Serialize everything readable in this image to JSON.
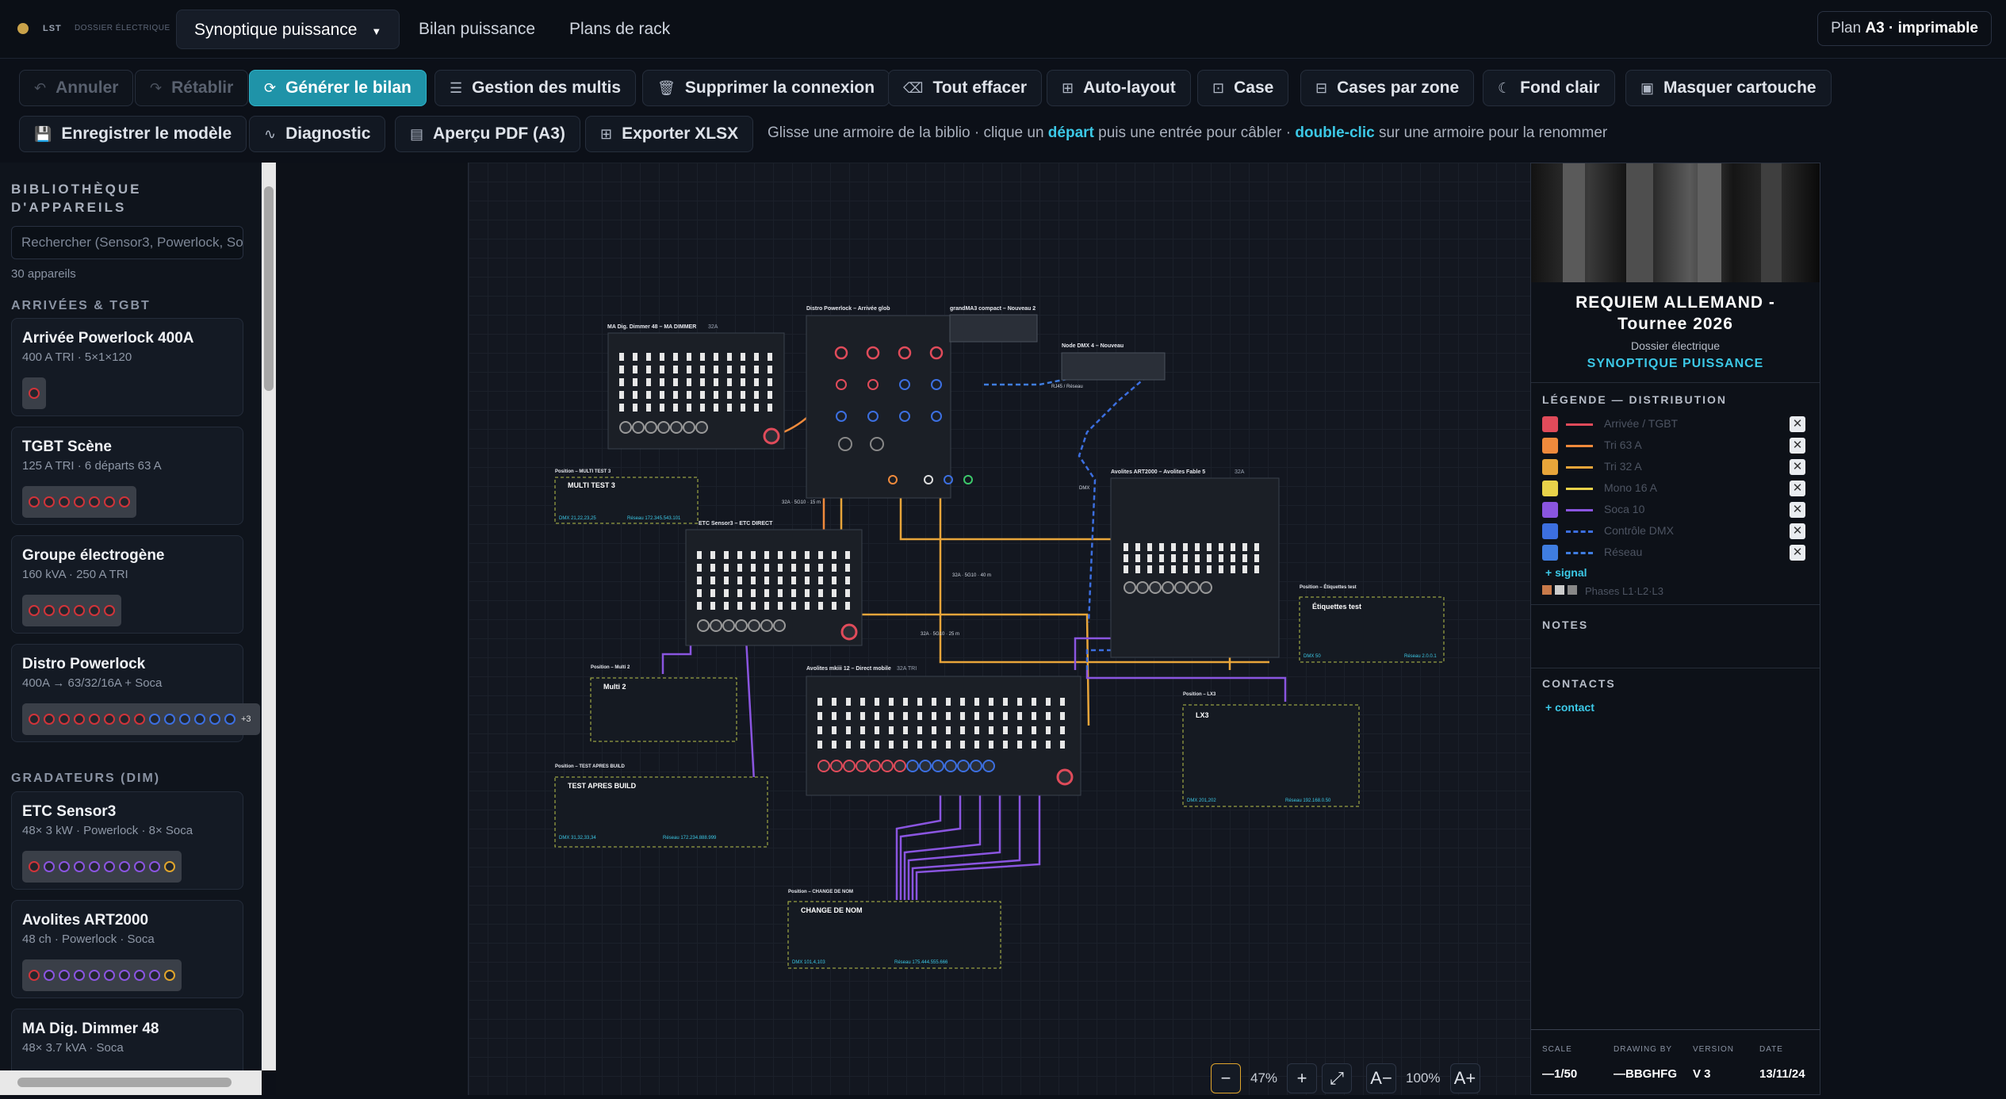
{
  "app": {
    "brand": "LST",
    "brand_sub": "DOSSIER ÉLECTRIQUE"
  },
  "tabs": [
    {
      "label": "Synoptique puissance",
      "active": true
    },
    {
      "label": "Bilan puissance"
    },
    {
      "label": "Plans de rack"
    }
  ],
  "plan": {
    "prefix": "Plan",
    "format": "A3 · imprimable"
  },
  "toolbar": {
    "undo": "Annuler",
    "redo": "Rétablir",
    "generate": "Générer le bilan",
    "multis": "Gestion des multis",
    "delete_conn": "Supprimer la connexion",
    "clear_all": "Tout effacer",
    "auto_layout": "Auto-layout",
    "box": "Case",
    "boxes_by_zone": "Cases par zone",
    "light_bg": "Fond clair",
    "hide_cartouche": "Masquer cartouche",
    "save_model": "Enregistrer le modèle",
    "diagnostic": "Diagnostic",
    "pdf_preview": "Aperçu PDF (A3)",
    "export_xlsx": "Exporter XLSX"
  },
  "hint": {
    "a": "Glisse une armoire de la biblio · clique un ",
    "b": "départ",
    "c": " puis une entrée pour câbler · ",
    "d": "double-clic",
    "e": " sur une armoire pour la renommer"
  },
  "sidebar": {
    "title": "BIBLIOTHÈQUE D'APPAREILS",
    "search_placeholder": "Rechercher (Sensor3, Powerlock, Soca...)",
    "count": "30 appareils",
    "section_arrivals": "ARRIVÉES & TGBT",
    "section_dimmers": "GRADATEURS (DIM)",
    "devices": [
      {
        "name": "Arrivée Powerlock 400A",
        "spec": "400 A TRI · 5×1×120"
      },
      {
        "name": "TGBT Scène",
        "spec": "125 A TRI · 6 départs 63 A"
      },
      {
        "name": "Groupe électrogène",
        "spec": "160 kVA · 250 A TRI"
      },
      {
        "name": "Distro Powerlock",
        "spec": "400A → 63/32/16A + Soca",
        "more": "+3"
      },
      {
        "name": "ETC Sensor3",
        "spec": "48× 3 kW · Powerlock · 8× Soca"
      },
      {
        "name": "Avolites ART2000",
        "spec": "48 ch · Powerlock · Soca"
      },
      {
        "name": "MA Dig. Dimmer 48",
        "spec": "48× 3.7 kVA · Soca"
      }
    ]
  },
  "canvas": {
    "blocks": {
      "ma": {
        "title": "MA Dig. Dimmer 48 – MA DIMMER",
        "rating": "32A"
      },
      "distro": {
        "title": "Distro Powerlock – Arrivée glob"
      },
      "grandma": {
        "title": "grandMA3 compact – Nouveau 2"
      },
      "node": {
        "title": "Node DMX 4 – Nouveau"
      },
      "avo": {
        "title": "Avolites ART2000 – Avolites Fable 5",
        "rating": "32A"
      },
      "etc": {
        "title": "ETC Sensor3 – ETC DIRECT"
      },
      "avo2": {
        "title": "Avolites mkiii 12 – Direct mobile",
        "rating": "32A TRI"
      },
      "multi3": {
        "pos": "Position – MULTI TEST 3",
        "name": "MULTI TEST 3",
        "dmx": "DMX 21,22,23,25",
        "net": "Réseau 172.345.543.101"
      },
      "multi2": {
        "pos": "Position – Multi 2",
        "name": "Multi 2"
      },
      "testapres": {
        "pos": "Position – TEST APRES BUILD",
        "name": "TEST APRES BUILD",
        "dmx": "DMX 31,32,33,34",
        "net": "Réseau 172.234.888.999"
      },
      "etiq": {
        "pos": "Position – Étiquettes test",
        "name": "Étiquettes test",
        "dmx": "DMX 50",
        "net": "Réseau 2.0.0.1"
      },
      "lx3": {
        "pos": "Position – LX3",
        "name": "LX3",
        "dmx": "DMX 201,202",
        "net": "Réseau 192.168.0.50"
      },
      "change": {
        "pos": "Position – CHANGE DE NOM",
        "name": "CHANGE DE NOM",
        "dmx": "DMX 101,4,103",
        "net": "Réseau 175.444.555.666"
      }
    },
    "cable_labels": [
      "32A · 5G10 · 15 m",
      "32A · 5G10 · 40 m",
      "32A · 5G10 · 25 m",
      "RJ45 / Réseau",
      "DMX"
    ]
  },
  "zoom": {
    "level": "47%",
    "text_size": "100%",
    "minus": "−",
    "plus": "+",
    "fit": "⤢",
    "a_minus": "A−",
    "a_plus": "A+"
  },
  "cartouche": {
    "title_line1": "REQUIEM ALLEMAND -",
    "title_line2": "Tournee 2026",
    "subtitle": "Dossier électrique",
    "tag": "SYNOPTIQUE PUISSANCE",
    "legend_title": "LÉGENDE — DISTRIBUTION",
    "legend": [
      {
        "label": "Arrivée / TGBT",
        "color": "#e04b5a"
      },
      {
        "label": "Tri 63 A",
        "color": "#ef8a3c"
      },
      {
        "label": "Tri 32 A",
        "color": "#e8a53a"
      },
      {
        "label": "Mono 16 A",
        "color": "#e8d24a"
      },
      {
        "label": "Soca 10",
        "color": "#8a55e0"
      },
      {
        "label": "Contrôle DMX",
        "color": "#3c6fe0",
        "dashed": true
      },
      {
        "label": "Réseau",
        "color": "#3f7de0",
        "dashed": true
      }
    ],
    "add_signal": "+ signal",
    "phases": "Phases L1·L2·L3",
    "notes": "NOTES",
    "contacts": "CONTACTS",
    "add_contact": "+ contact",
    "fields": [
      {
        "label": "SCALE",
        "value": "—1/50"
      },
      {
        "label": "DRAWING BY",
        "value": "—BBGHFG"
      },
      {
        "label": "VERSION",
        "value": "V 3"
      },
      {
        "label": "DATE",
        "value": "13/11/24"
      }
    ]
  }
}
